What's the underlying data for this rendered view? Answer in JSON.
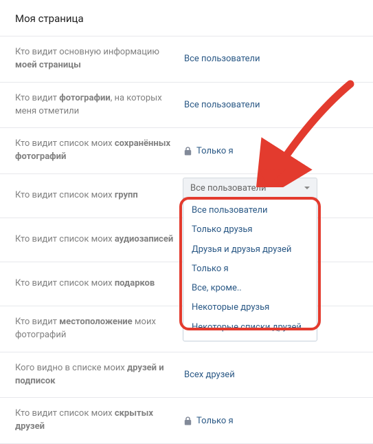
{
  "pageTitle": "Моя страница",
  "settings": [
    {
      "labelPlain": "Кто видит основную информацию ",
      "labelBold": "моей страницы",
      "value": "Все пользователи",
      "locked": false
    },
    {
      "labelPlain": "Кто видит ",
      "labelBold": "фотографии",
      "labelSuffix": ", на которых меня отметили",
      "value": "Все пользователи",
      "locked": false
    },
    {
      "labelPlain": "Кто видит список моих ",
      "labelBold": "сохранённых фотографий",
      "value": "Только я",
      "locked": true
    },
    {
      "labelPlain": "Кто видит список моих ",
      "labelBold": "групп",
      "value": "Все пользователи",
      "locked": false,
      "activeDropdown": true
    },
    {
      "labelPlain": "Кто видит список моих ",
      "labelBold": "аудиозаписей",
      "value": "",
      "locked": false
    },
    {
      "labelPlain": "Кто видит список моих ",
      "labelBold": "подарков",
      "value": "",
      "locked": false
    },
    {
      "labelPlain": "Кто видит ",
      "labelBold": "местоположение",
      "labelSuffix": " моих фотографий",
      "value": "",
      "locked": false
    },
    {
      "labelPlain": "Кого видно в списке моих ",
      "labelBold": "друзей и подписок",
      "value": "Всех друзей",
      "locked": false
    },
    {
      "labelPlain": "Кто видит список моих ",
      "labelBold": "скрытых друзей",
      "value": "Только я",
      "locked": true
    }
  ],
  "dropdown": {
    "selected": "Все пользователи",
    "options": [
      "Все пользователи",
      "Только друзья",
      "Друзья и друзья друзей",
      "Только я",
      "Все, кроме..",
      "Некоторые друзья",
      "Некоторые списки друзей"
    ]
  },
  "colors": {
    "linkColor": "#2a5885",
    "labelColor": "#808080",
    "highlight": "#e33b2e"
  }
}
